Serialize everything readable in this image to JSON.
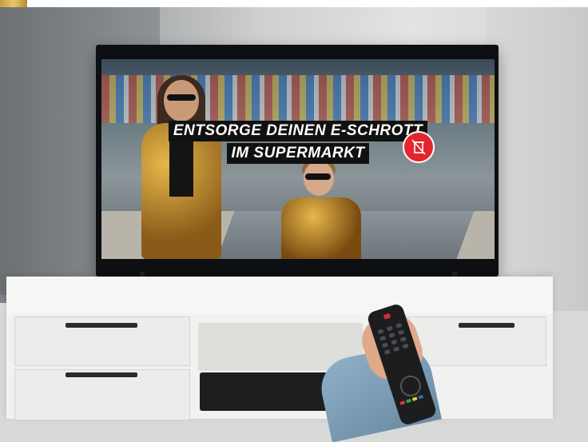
{
  "tv": {
    "headline_line1": "ENTSORGE DEINEN E-SCHROTT",
    "headline_line2": "IM SUPERMARKT",
    "badge_icon": "recycle-bin-crossed-icon",
    "badge_color": "#e3262d"
  },
  "scene": {
    "furniture": "tv-cabinet",
    "remote_icon": "tv-remote-icon"
  }
}
